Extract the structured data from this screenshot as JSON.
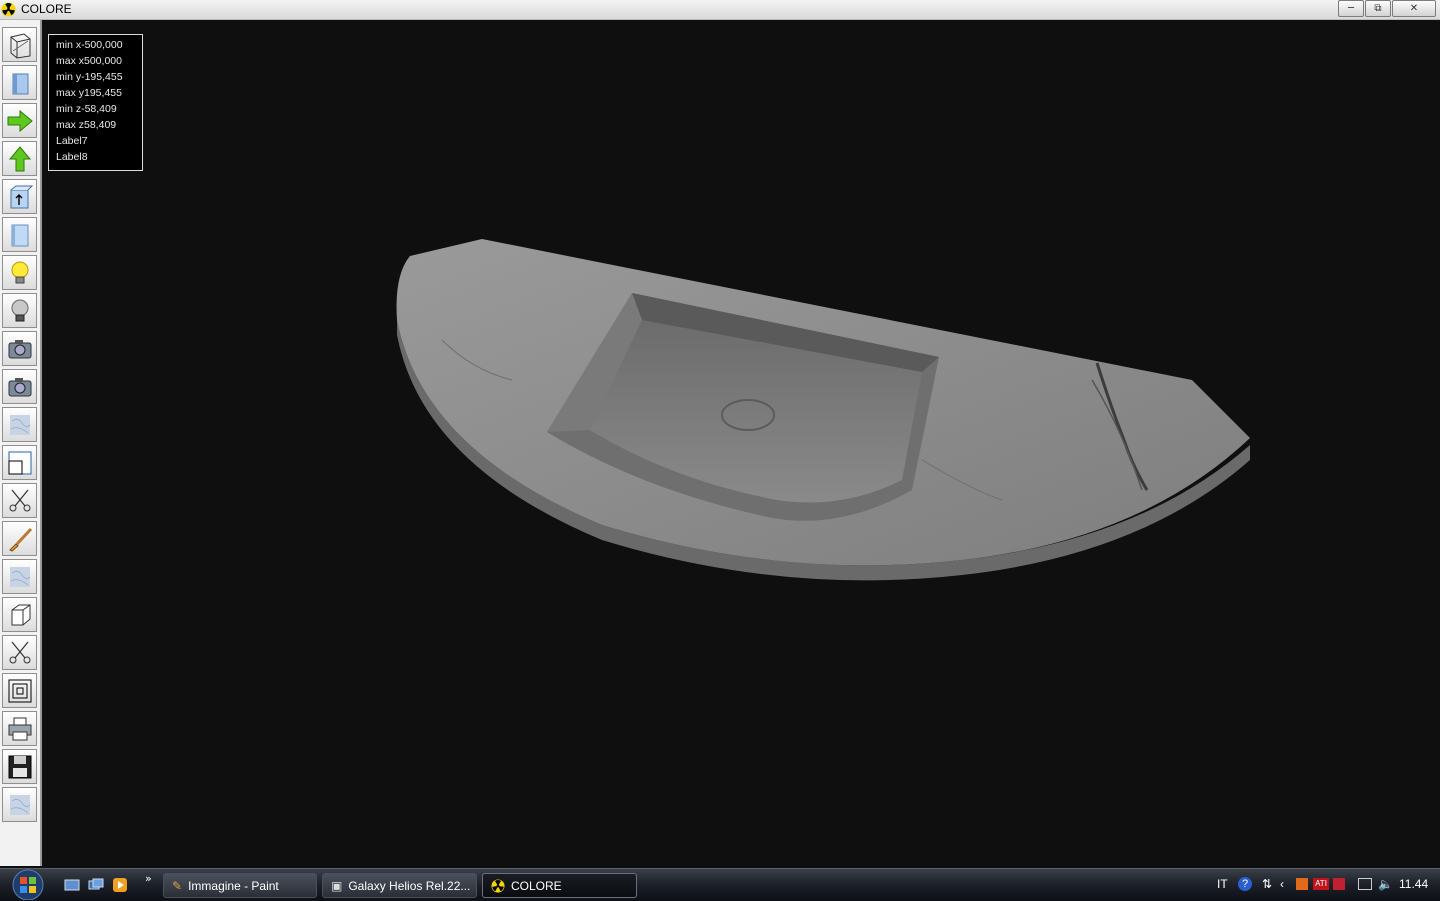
{
  "window": {
    "title": "COLORE",
    "icon": "radiation-icon"
  },
  "toolbar_items": [
    {
      "icon": "wireframe-box-icon"
    },
    {
      "icon": "solid-panel-icon"
    },
    {
      "icon": "arrow-right-green-icon"
    },
    {
      "icon": "arrow-up-green-icon"
    },
    {
      "icon": "box-arrow-up-icon"
    },
    {
      "icon": "glass-panel-icon"
    },
    {
      "icon": "lightbulb-on-icon"
    },
    {
      "icon": "lightbulb-off-icon"
    },
    {
      "icon": "camera-icon"
    },
    {
      "icon": "camera-icon"
    },
    {
      "icon": "marble-texture-icon"
    },
    {
      "icon": "resize-box-icon"
    },
    {
      "icon": "scissors-icon"
    },
    {
      "icon": "brush-icon"
    },
    {
      "icon": "marble-texture-icon"
    },
    {
      "icon": "cube-icon"
    },
    {
      "icon": "scissors-icon"
    },
    {
      "icon": "concentric-squares-icon"
    },
    {
      "icon": "printer-icon"
    },
    {
      "icon": "floppy-disk-icon"
    },
    {
      "icon": "marble-texture-icon"
    }
  ],
  "bounds": {
    "lines": [
      "min x-500,000",
      "max x500,000",
      "min y-195,455",
      "max y195,455",
      "min z-58,409",
      "max z58,409",
      "Label7",
      "Label8"
    ]
  },
  "taskbar": {
    "tasks": [
      {
        "label": "Immagine - Paint",
        "icon": "paint-icon",
        "active": false
      },
      {
        "label": "Galaxy Helios  Rel.22...",
        "icon": "folder-app-icon",
        "active": false
      },
      {
        "label": "COLORE",
        "icon": "radiation-icon",
        "active": true
      }
    ],
    "overflow": "»",
    "language": "IT",
    "clock": "11.44"
  },
  "colors": {
    "background": "#0f0f0f",
    "marble": "#8a8a8a"
  }
}
